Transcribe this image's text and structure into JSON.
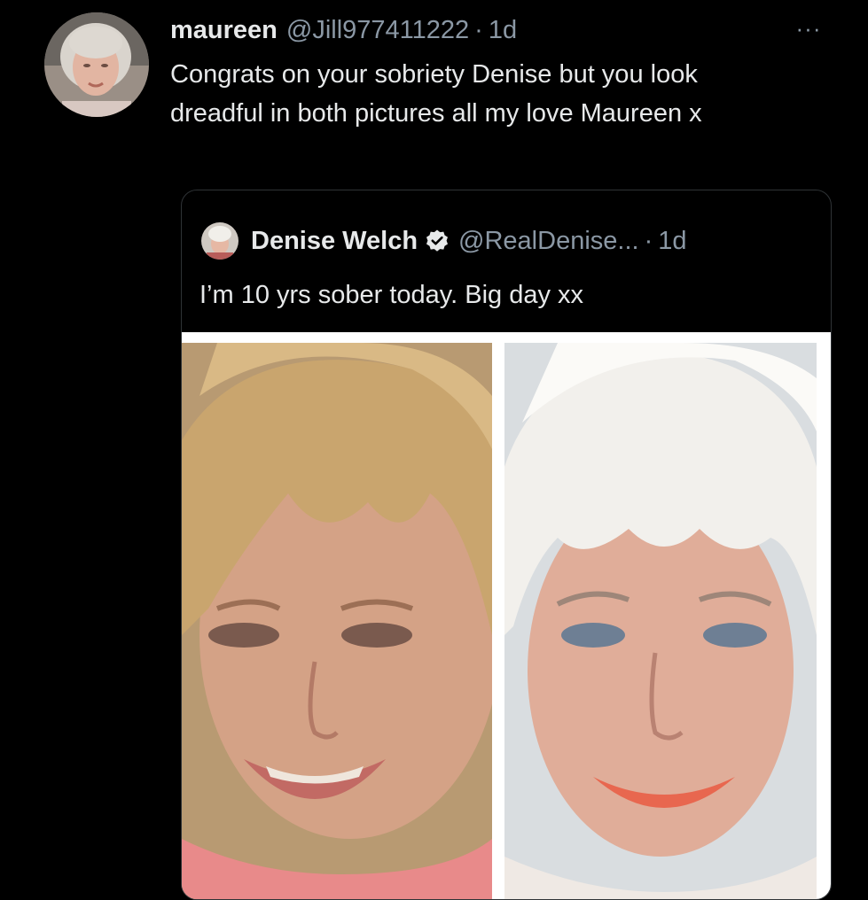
{
  "tweet": {
    "display_name": "maureen",
    "handle": "@Jill977411222",
    "separator": "·",
    "time": "1d",
    "more_label": "···",
    "text": "Congrats on your sobriety Denise but you look dreadful in both pictures all my love Maureen x"
  },
  "quoted_tweet": {
    "display_name": "Denise Welch",
    "verified": true,
    "handle": "@RealDenise...",
    "separator": "·",
    "time": "1d",
    "text": "I’m 10 yrs sober today. Big day xx"
  },
  "colors": {
    "background": "#000000",
    "primary_text": "#e7e9ea",
    "secondary_text": "#8b98a5",
    "card_border": "#2f3336"
  },
  "icons": {
    "more": "more-horizontal-icon",
    "verified": "verified-badge-icon"
  }
}
